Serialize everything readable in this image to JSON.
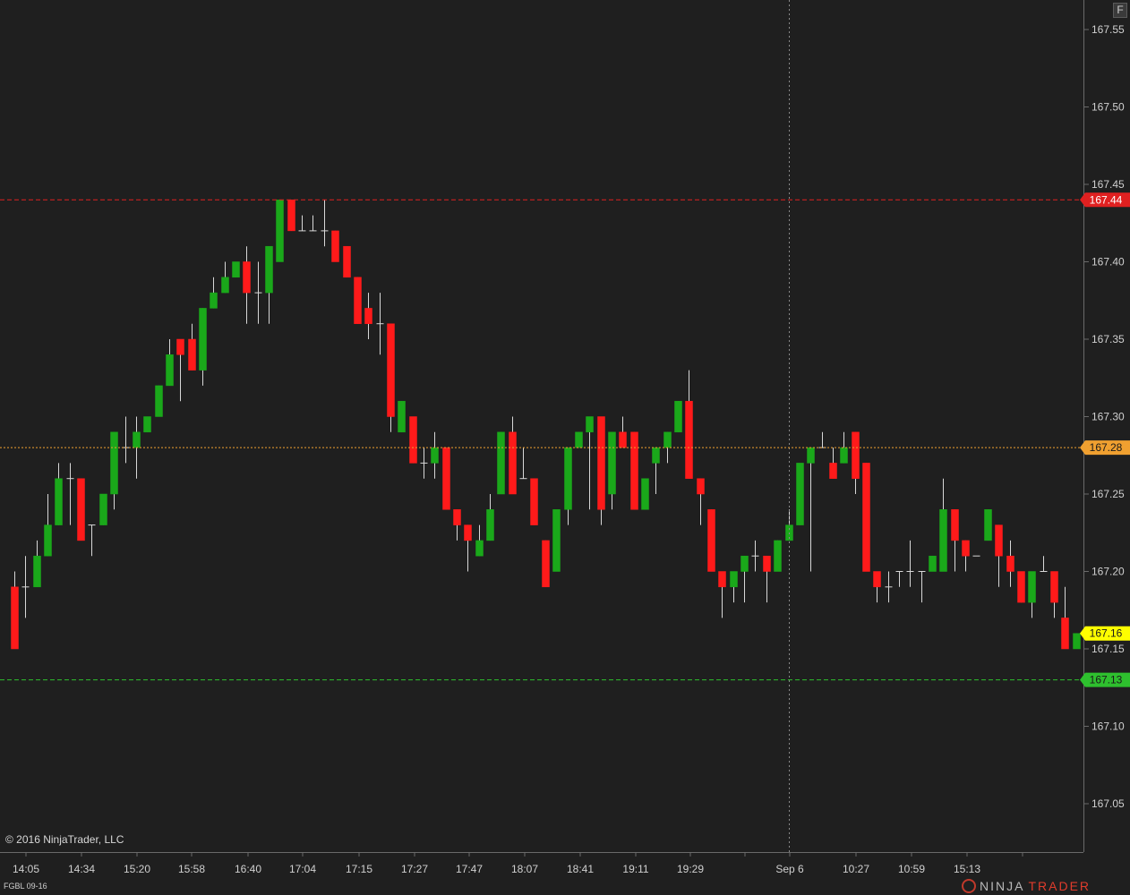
{
  "chart_data": {
    "type": "candlestick",
    "x_labels": [
      "14:05",
      "14:34",
      "15:20",
      "15:58",
      "16:40",
      "17:04",
      "17:15",
      "17:27",
      "17:47",
      "18:07",
      "18:41",
      "19:11",
      "19:29",
      "Sep 6",
      "10:27",
      "10:59",
      "15:13"
    ],
    "y_ticks": [
      "167.55",
      "167.50",
      "167.45",
      "167.40",
      "167.35",
      "167.30",
      "167.25",
      "167.20",
      "167.15",
      "167.10",
      "167.05"
    ],
    "ylim": [
      167.01,
      167.565
    ],
    "candles": [
      [
        167.19,
        167.2,
        167.15,
        167.15
      ],
      [
        167.19,
        167.21,
        167.17,
        167.19
      ],
      [
        167.19,
        167.22,
        167.19,
        167.21
      ],
      [
        167.21,
        167.25,
        167.21,
        167.23
      ],
      [
        167.23,
        167.27,
        167.23,
        167.26
      ],
      [
        167.26,
        167.27,
        167.23,
        167.26
      ],
      [
        167.26,
        167.26,
        167.22,
        167.22
      ],
      [
        167.23,
        167.23,
        167.21,
        167.23
      ],
      [
        167.23,
        167.25,
        167.23,
        167.25
      ],
      [
        167.25,
        167.29,
        167.24,
        167.29
      ],
      [
        167.28,
        167.3,
        167.27,
        167.28
      ],
      [
        167.28,
        167.3,
        167.26,
        167.29
      ],
      [
        167.29,
        167.3,
        167.29,
        167.3
      ],
      [
        167.3,
        167.32,
        167.3,
        167.32
      ],
      [
        167.32,
        167.35,
        167.32,
        167.34
      ],
      [
        167.35,
        167.35,
        167.31,
        167.34
      ],
      [
        167.35,
        167.36,
        167.33,
        167.33
      ],
      [
        167.33,
        167.37,
        167.32,
        167.37
      ],
      [
        167.37,
        167.39,
        167.37,
        167.38
      ],
      [
        167.38,
        167.4,
        167.38,
        167.39
      ],
      [
        167.39,
        167.4,
        167.39,
        167.4
      ],
      [
        167.4,
        167.41,
        167.36,
        167.38
      ],
      [
        167.38,
        167.4,
        167.36,
        167.38
      ],
      [
        167.38,
        167.41,
        167.36,
        167.41
      ],
      [
        167.4,
        167.44,
        167.4,
        167.44
      ],
      [
        167.44,
        167.44,
        167.42,
        167.42
      ],
      [
        167.42,
        167.43,
        167.42,
        167.42
      ],
      [
        167.42,
        167.43,
        167.42,
        167.42
      ],
      [
        167.42,
        167.44,
        167.41,
        167.42
      ],
      [
        167.42,
        167.42,
        167.4,
        167.4
      ],
      [
        167.41,
        167.41,
        167.39,
        167.39
      ],
      [
        167.39,
        167.39,
        167.36,
        167.36
      ],
      [
        167.37,
        167.38,
        167.35,
        167.36
      ],
      [
        167.36,
        167.38,
        167.34,
        167.36
      ],
      [
        167.36,
        167.36,
        167.29,
        167.3
      ],
      [
        167.29,
        167.31,
        167.29,
        167.31
      ],
      [
        167.3,
        167.3,
        167.27,
        167.27
      ],
      [
        167.27,
        167.28,
        167.26,
        167.27
      ],
      [
        167.27,
        167.29,
        167.26,
        167.28
      ],
      [
        167.28,
        167.28,
        167.24,
        167.24
      ],
      [
        167.24,
        167.24,
        167.22,
        167.23
      ],
      [
        167.23,
        167.23,
        167.2,
        167.22
      ],
      [
        167.21,
        167.23,
        167.21,
        167.22
      ],
      [
        167.22,
        167.25,
        167.22,
        167.24
      ],
      [
        167.25,
        167.29,
        167.25,
        167.29
      ],
      [
        167.29,
        167.3,
        167.26,
        167.25
      ],
      [
        167.26,
        167.28,
        167.26,
        167.26
      ],
      [
        167.26,
        167.26,
        167.23,
        167.23
      ],
      [
        167.22,
        167.22,
        167.19,
        167.19
      ],
      [
        167.2,
        167.23,
        167.2,
        167.24
      ],
      [
        167.24,
        167.28,
        167.23,
        167.28
      ],
      [
        167.28,
        167.29,
        167.28,
        167.29
      ],
      [
        167.29,
        167.3,
        167.24,
        167.3
      ],
      [
        167.3,
        167.3,
        167.23,
        167.24
      ],
      [
        167.25,
        167.29,
        167.24,
        167.29
      ],
      [
        167.29,
        167.3,
        167.28,
        167.28
      ],
      [
        167.29,
        167.29,
        167.24,
        167.24
      ],
      [
        167.24,
        167.26,
        167.24,
        167.26
      ],
      [
        167.27,
        167.28,
        167.25,
        167.28
      ],
      [
        167.28,
        167.29,
        167.27,
        167.29
      ],
      [
        167.29,
        167.31,
        167.29,
        167.31
      ],
      [
        167.31,
        167.33,
        167.26,
        167.26
      ],
      [
        167.26,
        167.26,
        167.23,
        167.25
      ],
      [
        167.24,
        167.24,
        167.2,
        167.2
      ],
      [
        167.2,
        167.2,
        167.17,
        167.19
      ],
      [
        167.19,
        167.2,
        167.18,
        167.2
      ],
      [
        167.2,
        167.21,
        167.18,
        167.21
      ],
      [
        167.21,
        167.22,
        167.2,
        167.21
      ],
      [
        167.21,
        167.21,
        167.18,
        167.2
      ],
      [
        167.2,
        167.22,
        167.2,
        167.22
      ],
      [
        167.22,
        167.24,
        167.22,
        167.23
      ],
      [
        167.23,
        167.24,
        167.23,
        167.27
      ],
      [
        167.27,
        167.28,
        167.2,
        167.28
      ],
      [
        167.28,
        167.29,
        167.28,
        167.28
      ],
      [
        167.27,
        167.28,
        167.26,
        167.26
      ],
      [
        167.27,
        167.29,
        167.27,
        167.28
      ],
      [
        167.29,
        167.29,
        167.25,
        167.26
      ],
      [
        167.27,
        167.27,
        167.2,
        167.2
      ],
      [
        167.2,
        167.2,
        167.18,
        167.19
      ],
      [
        167.19,
        167.2,
        167.18,
        167.19
      ],
      [
        167.2,
        167.2,
        167.19,
        167.2
      ],
      [
        167.2,
        167.22,
        167.19,
        167.2
      ],
      [
        167.2,
        167.2,
        167.18,
        167.2
      ],
      [
        167.2,
        167.21,
        167.2,
        167.21
      ],
      [
        167.2,
        167.26,
        167.2,
        167.24
      ],
      [
        167.24,
        167.24,
        167.2,
        167.22
      ],
      [
        167.22,
        167.22,
        167.2,
        167.21
      ],
      [
        167.21,
        167.21,
        167.21,
        167.21
      ],
      [
        167.22,
        167.24,
        167.22,
        167.24
      ],
      [
        167.23,
        167.23,
        167.19,
        167.21
      ],
      [
        167.21,
        167.22,
        167.19,
        167.2
      ],
      [
        167.2,
        167.2,
        167.18,
        167.18
      ],
      [
        167.18,
        167.2,
        167.17,
        167.2
      ],
      [
        167.2,
        167.21,
        167.2,
        167.2
      ],
      [
        167.2,
        167.2,
        167.17,
        167.18
      ],
      [
        167.17,
        167.19,
        167.15,
        167.15
      ],
      [
        167.15,
        167.16,
        167.15,
        167.16
      ]
    ],
    "levels": [
      {
        "value": "167.44",
        "color": "#e02020",
        "label_text_color": "#ffffff"
      },
      {
        "value": "167.28",
        "color": "#f0a030",
        "label_text_color": "#1a1a1a"
      },
      {
        "value": "167.16",
        "color": "#ffff00",
        "label_text_color": "#1a1a1a"
      },
      {
        "value": "167.13",
        "color": "#2ec02e",
        "label_text_color": "#1a1a1a"
      }
    ],
    "crosshair": {
      "x_label": "Sep 6"
    },
    "colors": {
      "up": "#1aa81a",
      "down": "#ff1a1a",
      "wick": "#d8d8d8",
      "background": "#1f1f1f",
      "axis": "#6a6a6a",
      "text": "#d0d0d0"
    }
  },
  "footer": {
    "copyright": "© 2016 NinjaTrader, LLC",
    "instrument": "FGBL 09-16",
    "brand_main": "NINJA",
    "brand_accent": "TRADER"
  },
  "toolbar": {
    "f_label": "F"
  }
}
